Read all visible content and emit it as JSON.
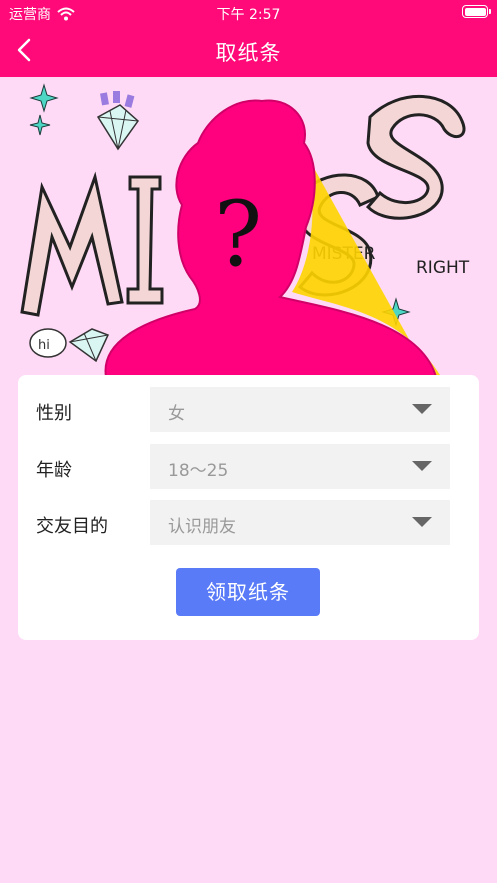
{
  "status_bar": {
    "carrier": "运营商",
    "time": "下午 2:57"
  },
  "nav": {
    "title": "取纸条",
    "back_icon": "chevron-left-icon"
  },
  "banner": {
    "big_text": "MISS",
    "question_mark": "?",
    "sub_left": "MISTER",
    "sub_right": "RIGHT",
    "hi": "hi"
  },
  "form": {
    "rows": [
      {
        "label": "性别",
        "value": "女"
      },
      {
        "label": "年龄",
        "value": "18～25"
      },
      {
        "label": "交友目的",
        "value": "认识朋友"
      }
    ],
    "submit_label": "领取纸条"
  },
  "colors": {
    "brand": "#ff0a78",
    "background": "#ffdaf6",
    "button": "#5a7bf7"
  }
}
